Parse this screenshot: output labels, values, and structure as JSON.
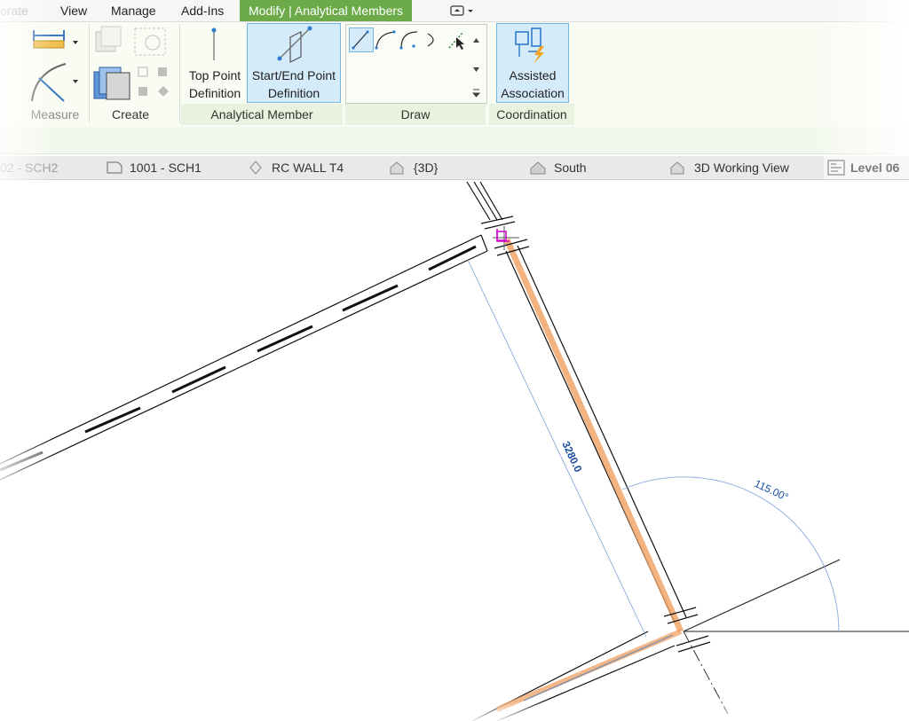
{
  "menu": {
    "tabs": [
      {
        "label": "orate"
      },
      {
        "label": "View"
      },
      {
        "label": "Manage"
      },
      {
        "label": "Add-Ins"
      },
      {
        "label": "Modify | Analytical Members"
      }
    ]
  },
  "ribbon": {
    "panels": {
      "measure": "Measure",
      "create": "Create",
      "analytical_member": "Analytical Member",
      "draw": "Draw",
      "coordination": "Coordination"
    },
    "buttons": {
      "top_point_l1": "Top Point",
      "top_point_l2": "Definition",
      "start_end_l1": "Start/End Point",
      "start_end_l2": "Definition",
      "assisted_l1": "Assisted",
      "assisted_l2": "Association"
    }
  },
  "view_tabs": [
    {
      "label": "02 - SCH2"
    },
    {
      "label": "1001 - SCH1"
    },
    {
      "label": "RC WALL T4"
    },
    {
      "label": "{3D}"
    },
    {
      "label": "South"
    },
    {
      "label": "3D Working View"
    },
    {
      "label": "Level 06"
    }
  ],
  "canvas": {
    "dimension_length": "3280.0",
    "angle": "115.00°"
  },
  "colors": {
    "accent_tab": "#6dab4a",
    "highlight": "#f0a060",
    "dimension": "#1a4fa0"
  }
}
